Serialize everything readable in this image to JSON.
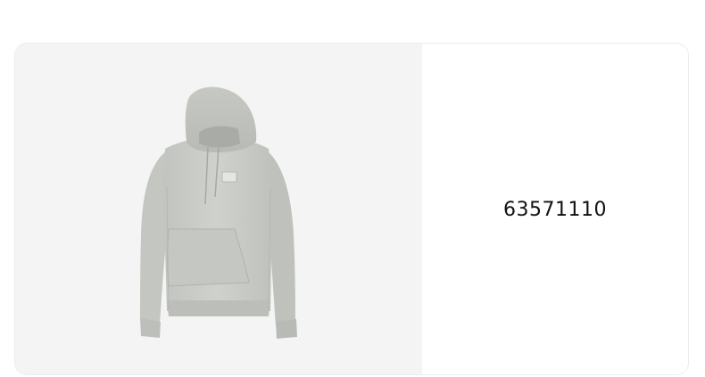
{
  "product": {
    "code": "63571110",
    "image_alt": "grey hoodie",
    "garment_color": "#c9ccc6",
    "panel_background": "#f4f4f4"
  }
}
